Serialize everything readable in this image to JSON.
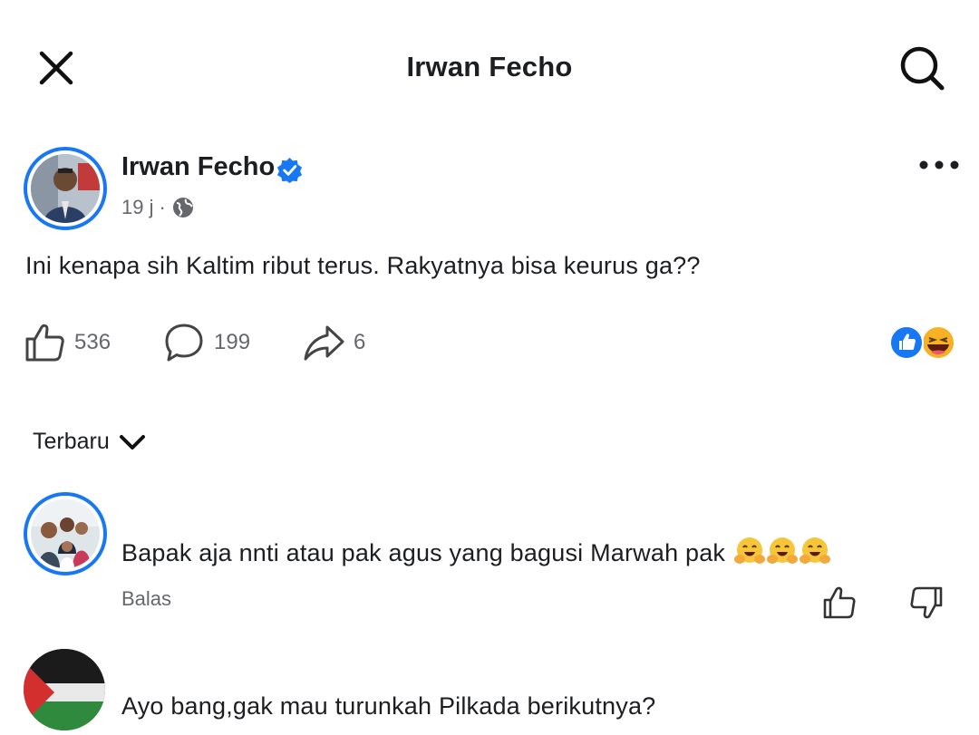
{
  "header": {
    "title": "Irwan Fecho",
    "close_icon": "close-icon",
    "search_icon": "search-icon"
  },
  "post": {
    "author": "Irwan Fecho",
    "verified": true,
    "time": "19 j",
    "separator": "·",
    "audience_icon": "globe-icon",
    "text": "Ini kenapa sih Kaltim ribut terus. Rakyatnya bisa keurus ga??",
    "likes": "536",
    "comments": "199",
    "shares": "6",
    "reaction_icons": [
      "like-reaction-icon",
      "haha-reaction-icon"
    ]
  },
  "comments_section": {
    "sort_label": "Terbaru",
    "items": [
      {
        "text": "Bapak aja nnti atau pak agus yang bagusi Marwah pak",
        "emojis": [
          "hugging-face-emoji",
          "hugging-face-emoji",
          "hugging-face-emoji"
        ],
        "reply_label": "Balas"
      },
      {
        "text": "Ayo bang,gak mau turunkah Pilkada berikutnya?"
      }
    ]
  },
  "colors": {
    "accent": "#1877f2",
    "text": "#1c1e21",
    "secondary": "#65676b"
  }
}
